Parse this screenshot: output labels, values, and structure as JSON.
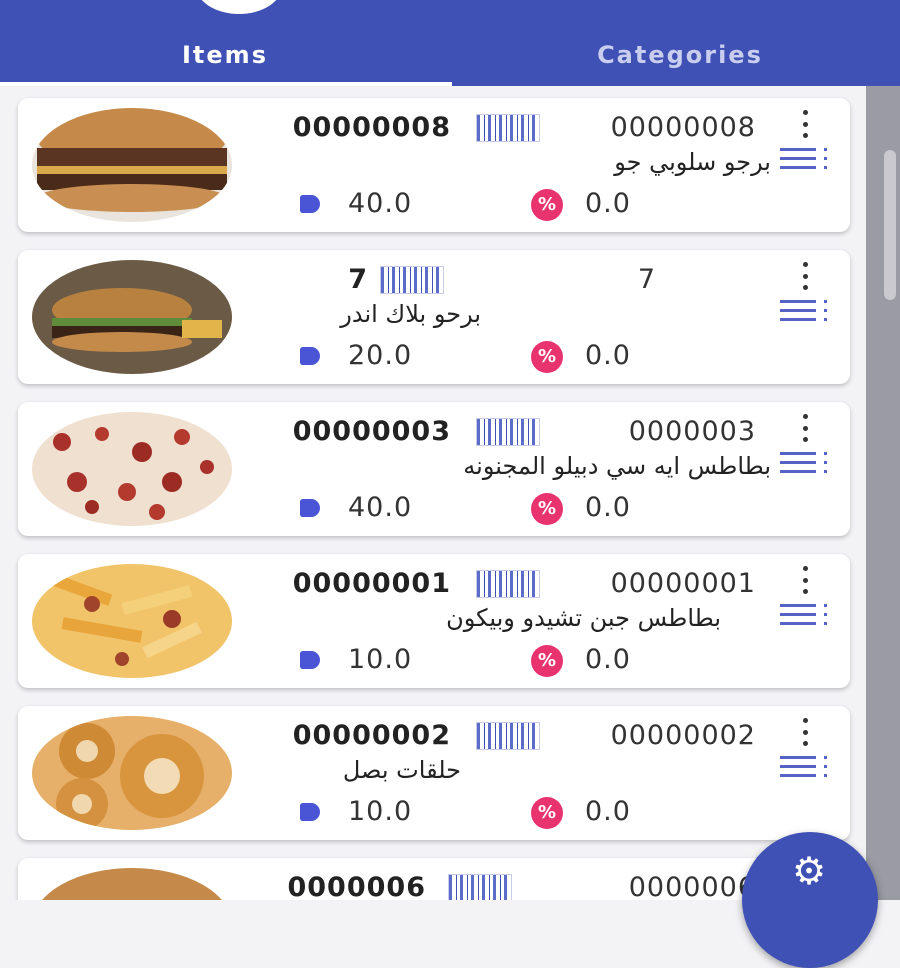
{
  "tabs": {
    "items": "Items",
    "categories": "Categories"
  },
  "items": [
    {
      "code_left": "00000008",
      "code_right": "00000008",
      "name": "برجو سلوبي جو",
      "price": "40.0",
      "discount": "0.0"
    },
    {
      "code_left": "7",
      "code_right": "7",
      "name": "برحو بلاك اندر",
      "price": "20.0",
      "discount": "0.0"
    },
    {
      "code_left": "00000003",
      "code_right": "0000003",
      "name": "بطاطس ايه سي دبيلو المجنونه",
      "price": "40.0",
      "discount": "0.0"
    },
    {
      "code_left": "00000001",
      "code_right": "00000001",
      "name": "بطاطس جبن تشيدو وبيكون",
      "price": "10.0",
      "discount": "0.0"
    },
    {
      "code_left": "00000002",
      "code_right": "00000002",
      "name": "حلقات بصل",
      "price": "10.0",
      "discount": "0.0"
    },
    {
      "code_left": "0000006",
      "code_right": "0000006",
      "name": "",
      "price": "",
      "discount": ""
    }
  ],
  "icons": {
    "barcode": "barcode-icon",
    "price": "price-tag-icon",
    "discount": "discount-icon",
    "menu": "more-vert-icon",
    "list": "list-icon",
    "fab": "gear-icon"
  },
  "colors": {
    "primary": "#3f51b5",
    "discount": "#e8336f",
    "price_tag": "#4a55d6"
  }
}
